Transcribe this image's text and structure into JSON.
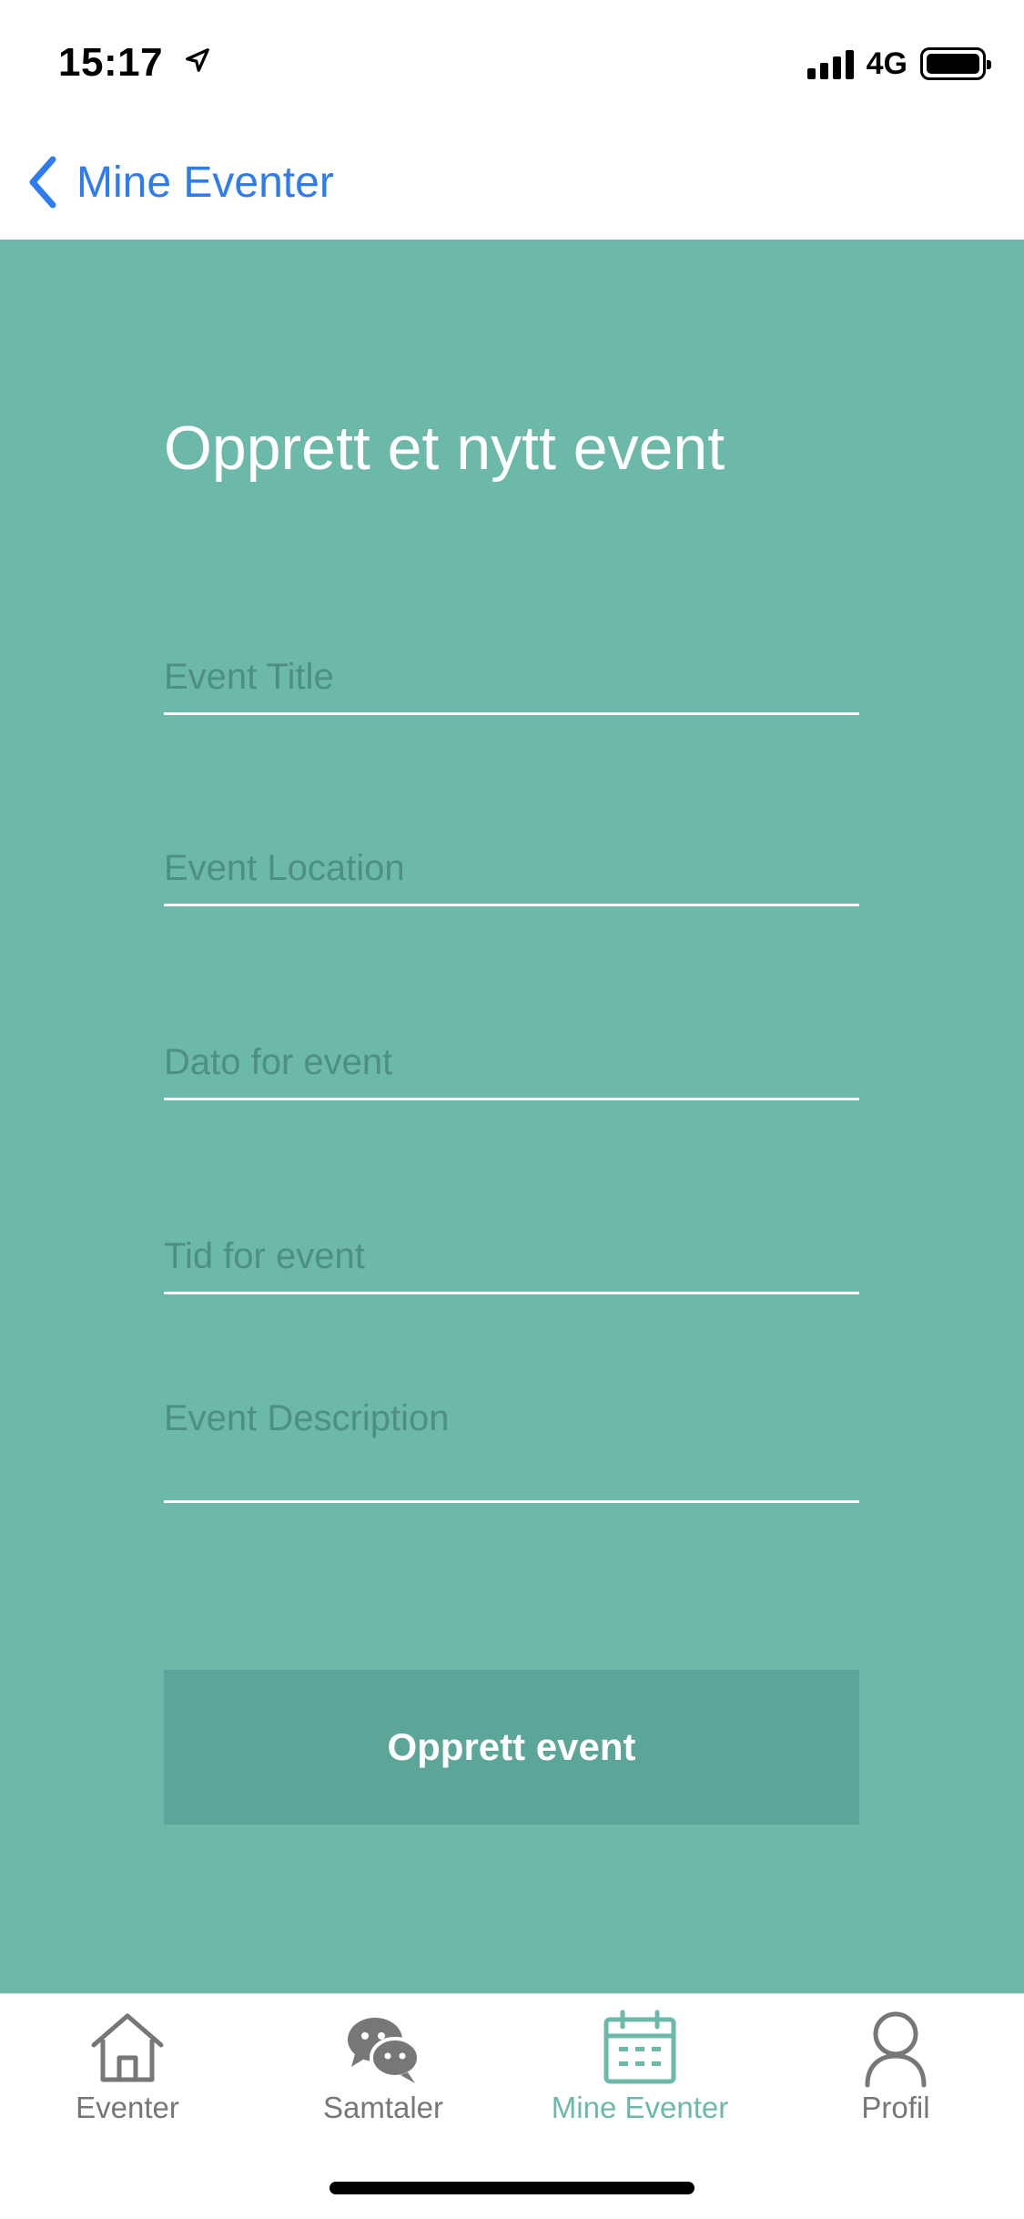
{
  "status_bar": {
    "time": "15:17",
    "network": "4G",
    "icons": [
      "location-arrow-icon",
      "signal-icon",
      "battery-icon"
    ]
  },
  "nav": {
    "back_label": "Mine Eventer",
    "back_icon": "chevron-left-icon",
    "accent_color": "#2f7cf0"
  },
  "form": {
    "title": "Opprett et nytt event",
    "background_color": "#6cb9a9",
    "fields": {
      "title": {
        "placeholder": "Event Title",
        "value": ""
      },
      "location": {
        "placeholder": "Event Location",
        "value": ""
      },
      "date": {
        "placeholder": "Dato for event",
        "value": ""
      },
      "time": {
        "placeholder": "Tid for event",
        "value": ""
      },
      "description": {
        "placeholder": "Event Description",
        "value": ""
      }
    },
    "submit_label": "Opprett event"
  },
  "tab_bar": {
    "active_color": "#6cb9a9",
    "inactive_color": "#777777",
    "tabs": [
      {
        "label": "Eventer",
        "icon": "home-icon",
        "active": false
      },
      {
        "label": "Samtaler",
        "icon": "chat-bubbles-icon",
        "active": false
      },
      {
        "label": "Mine Eventer",
        "icon": "calendar-icon",
        "active": true
      },
      {
        "label": "Profil",
        "icon": "person-icon",
        "active": false
      }
    ]
  }
}
